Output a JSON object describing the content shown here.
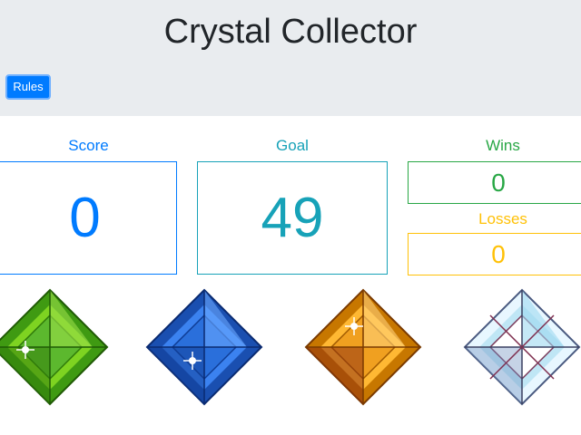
{
  "header": {
    "title": "Crystal Collector",
    "rules_label": "Rules"
  },
  "stats": {
    "score": {
      "label": "Score",
      "value": "0"
    },
    "goal": {
      "label": "Goal",
      "value": "49"
    },
    "wins": {
      "label": "Wins",
      "value": "0"
    },
    "losses": {
      "label": "Losses",
      "value": "0"
    }
  },
  "colors": {
    "score": "#007bff",
    "goal": "#17a2b8",
    "wins": "#28a745",
    "losses": "#ffc107",
    "header_bg": "#e9ecef",
    "button": "#007bff"
  },
  "crystals": [
    {
      "name": "green-crystal-icon",
      "color": "#5cb82e"
    },
    {
      "name": "blue-crystal-icon",
      "color": "#2a6fdb"
    },
    {
      "name": "orange-crystal-icon",
      "color": "#f0a020"
    },
    {
      "name": "diamond-crystal-icon",
      "color": "#bfe6f5"
    }
  ]
}
